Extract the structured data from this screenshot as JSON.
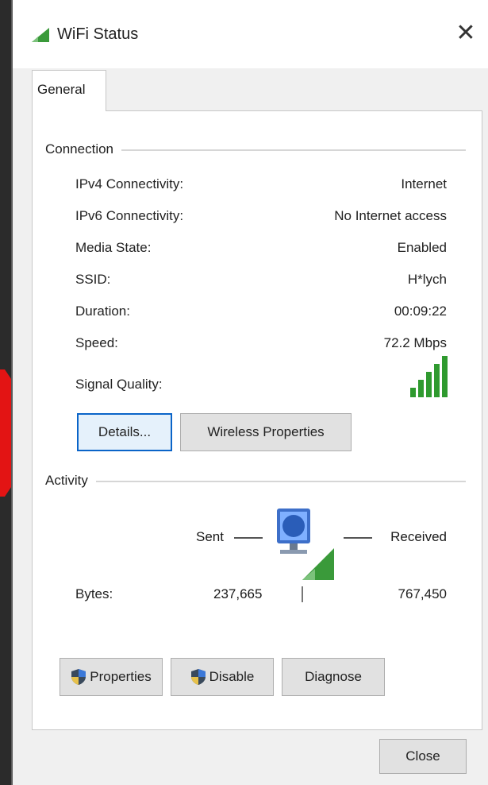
{
  "window": {
    "title": "WiFi Status",
    "close_glyph": "✕"
  },
  "tabs": [
    {
      "label": "General"
    }
  ],
  "connection": {
    "group_label": "Connection",
    "rows": [
      {
        "label": "IPv4 Connectivity:",
        "value": "Internet"
      },
      {
        "label": "IPv6 Connectivity:",
        "value": "No Internet access"
      },
      {
        "label": "Media State:",
        "value": "Enabled"
      },
      {
        "label": "SSID:",
        "value": "H*lych"
      },
      {
        "label": "Duration:",
        "value": "00:09:22"
      },
      {
        "label": "Speed:",
        "value": "72.2 Mbps"
      }
    ],
    "signal_quality_label": "Signal Quality:",
    "signal_bars_filled": 5,
    "signal_bars_total": 5,
    "details_button": "Details...",
    "wireless_properties_button": "Wireless Properties"
  },
  "activity": {
    "group_label": "Activity",
    "sent_label": "Sent",
    "received_label": "Received",
    "bytes_label": "Bytes:",
    "bytes_sent": "237,665",
    "bytes_received": "767,450"
  },
  "buttons": {
    "properties": "Properties",
    "disable": "Disable",
    "diagnose": "Diagnose",
    "close": "Close"
  },
  "colors": {
    "signal_green": "#2f9a2f",
    "accent_blue": "#0a64c8",
    "arrow_red": "#e31414"
  },
  "icons": {
    "title": "wifi-signal-icon",
    "network": "network-computer-icon",
    "shield": "uac-shield-icon"
  }
}
